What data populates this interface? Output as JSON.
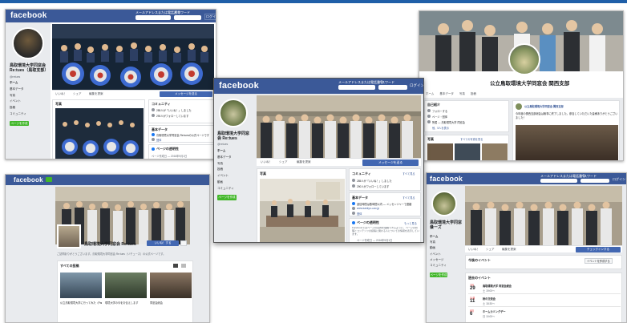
{
  "brand": {
    "logo": "facebook",
    "login": "ログイン",
    "email_label": "メールアドレスまたは電話番号",
    "password_label": "パスワード"
  },
  "page": {
    "name": "鳥取環境大学同窓会 Re:tues",
    "name_line1": "鳥取環境大学同窓会",
    "name_line2": "Re:tues",
    "handle": "@retues",
    "name_alt": "鳥取環境大学同窓会 Re:tues（鳥取支部）",
    "kansai": "公立鳥取環境大学同窓会 関西支部",
    "name_split_1": "鳥取環境大学同窓",
    "name_split_2": "会 Re:tues",
    "name_split_3": "鳥取環境大学同窓会",
    "name_split_4": "リーズ"
  },
  "nav": {
    "home": "ホーム",
    "basic": "基本データ",
    "photos": "写真",
    "events": "イベント",
    "posts": "投稿",
    "community": "コミュニティ",
    "videos": "動画",
    "messages": "メッセージ",
    "create_page": "ページを作成"
  },
  "actions": {
    "like": "いいね！",
    "share": "シェア",
    "suggest": "編集を提案",
    "send_message": "メッセージを送る",
    "like_btn": "いいね！する"
  },
  "panels": {
    "photos": "写真",
    "community": "コミュニティ",
    "community_stat1": "285人が「いいね！」しました",
    "community_stat2": "290人がフォローしています",
    "community_more": "すべて見る",
    "basic": "基本データ",
    "basic_desc": "鳥取環境大学同窓会 Re:tuesの公式ページです",
    "basic_msg": "返信時間は数時間以内 — メッセンジャーで連絡",
    "basic_link": "www.kankyo-u.ac.jp",
    "basic_category": "団体",
    "transparency": "ページの透明性",
    "transparency_more": "もっと見る",
    "transparency_text": "Facebookではページの目的を理解できるように、ページの管理とコンテンツの投稿に関わる人についての情報を表示しています。",
    "transparency_date": "ページ作成日 — 2016年9月1日",
    "intro": "自己紹介",
    "intro_follows": "フォローする",
    "intro_page_info": "ページ・団体",
    "intro_member": "所属 — 鳥取環境大学 同窓会",
    "intro_more": "他、5人を表示",
    "kansai_post_name": "公立鳥取環境大学同窓会 関西支部",
    "kansai_post_text": "今年度の関西支部総会は無事に終了しました。参加していただいた皆様ありがとうございました！",
    "photos_all": "すべての写真を見る",
    "all_posts": "すべての投稿",
    "upcoming": "今後のイベント",
    "past": "過去のイベント",
    "event_btn": "イベントを作成する",
    "greeting": "ご訪問ありがとうございます。鳥取環境大学同窓会 Re:tues（リチューズ）の公式ページです。",
    "video1": "公立鳥取環境大学に行ってみた（Part）",
    "video2": "環境大学の今をお伝えします",
    "video3": "同窓会総会",
    "checkin": "チェックインする"
  },
  "events": [
    {
      "month": "7月",
      "day": "29",
      "title": "鳥取環境大学 同窓会総会",
      "time": "土 19:00〜"
    },
    {
      "month": "11月",
      "day": "11",
      "title": "秋の交流会",
      "time": "土 18:30〜"
    },
    {
      "month": "8月",
      "day": "6",
      "title": "ホームカミングデー",
      "time": "日 10:00〜"
    }
  ],
  "colors": {
    "fb_blue": "#3b5998",
    "header_strip": "#1f5fa8",
    "green": "#42b72a",
    "button_blue": "#4267b2"
  }
}
